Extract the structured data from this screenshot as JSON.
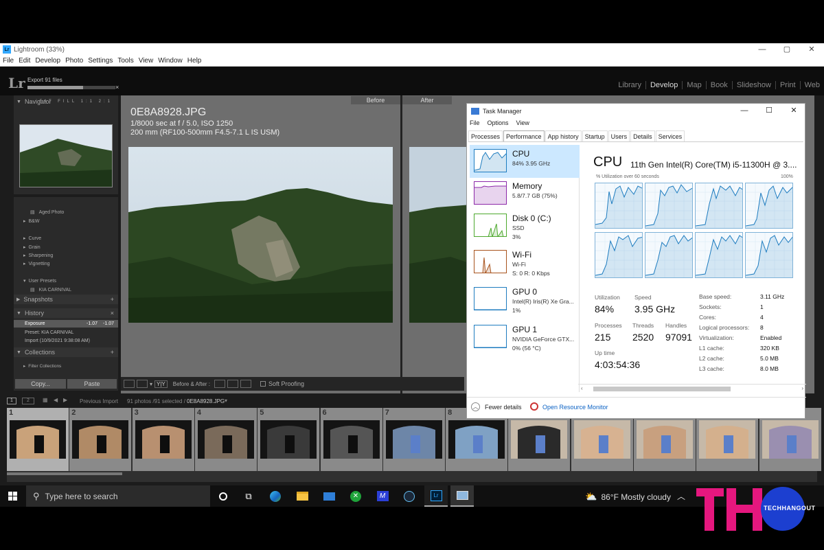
{
  "lightroom": {
    "title": "Lightroom (33%)",
    "window_controls": [
      "—",
      "▢",
      "✕"
    ],
    "menu": [
      "File",
      "Edit",
      "Develop",
      "Photo",
      "Settings",
      "Tools",
      "View",
      "Window",
      "Help"
    ],
    "logo": "Lr",
    "export_label": "Export 91 files",
    "export_close": "×",
    "export_progress": 0.63,
    "modules": [
      "Library",
      "Develop",
      "Map",
      "Book",
      "Slideshow",
      "Print",
      "Web"
    ],
    "active_module": "Develop",
    "navigator": {
      "title": "Navigator",
      "zoom_options": [
        "FIT",
        "FILL",
        "1:1",
        "2:1"
      ]
    },
    "presets": [
      "Aged Photo",
      "B&W",
      "Curve",
      "Grain",
      "Sharpening",
      "Vignetting",
      "User Presets",
      "KIA CARNIVAL"
    ],
    "snapshots_title": "Snapshots",
    "history": {
      "title": "History",
      "items": [
        {
          "label": "Exposure",
          "v1": "-1.07",
          "v2": "-1.07"
        },
        {
          "label": "Preset: KIA CARNIVAL",
          "v1": "",
          "v2": ""
        },
        {
          "label": "Import (10/9/2021 9:38:08 AM)",
          "v1": "",
          "v2": ""
        }
      ]
    },
    "collections_title": "Collections",
    "filter_collections": "Filter Collections",
    "copy_label": "Copy...",
    "paste_label": "Paste",
    "before_label": "Before",
    "after_label": "After",
    "photo": {
      "filename": "0E8A8928.JPG",
      "exposure": "1/8000 sec at f / 5.0, ISO 1250",
      "lens": "200 mm (RF100-500mm F4.5-7.1 L IS USM)"
    },
    "toolbar": {
      "yy": "Y|Y",
      "before_after": "Before & After :",
      "soft_proofing": "Soft Proofing"
    },
    "filmstrip_nav": {
      "source": "Previous Import",
      "count": "91 photos /91 selected /",
      "file": "0E8A8928.JPG"
    },
    "filmstrip_numbers": [
      "1",
      "2",
      "3",
      "4",
      "5",
      "6",
      "7",
      "8",
      "",
      "",
      "",
      "",
      ""
    ]
  },
  "task_manager": {
    "title": "Task Manager",
    "window_controls": [
      "—",
      "☐",
      "✕"
    ],
    "menu": [
      "File",
      "Options",
      "View"
    ],
    "tabs": [
      "Processes",
      "Performance",
      "App history",
      "Startup",
      "Users",
      "Details",
      "Services"
    ],
    "selected_tab": "Performance",
    "side_items": [
      {
        "name": "CPU",
        "sub1": "84%  3.95 GHz",
        "sub2": "",
        "color": "#1c7bbf"
      },
      {
        "name": "Memory",
        "sub1": "5.8/7.7 GB (75%)",
        "sub2": "",
        "color": "#8b27a8"
      },
      {
        "name": "Disk 0 (C:)",
        "sub1": "SSD",
        "sub2": "3%",
        "color": "#4ca82c"
      },
      {
        "name": "Wi-Fi",
        "sub1": "Wi-Fi",
        "sub2": "S: 0  R: 0 Kbps",
        "color": "#a7521b"
      },
      {
        "name": "GPU 0",
        "sub1": "Intel(R) Iris(R) Xe Gra...",
        "sub2": "1%",
        "color": "#1c7bbf"
      },
      {
        "name": "GPU 1",
        "sub1": "NVIDIA GeForce GTX...",
        "sub2": "0%  (56 °C)",
        "color": "#1c7bbf"
      }
    ],
    "cpu": {
      "title": "CPU",
      "model": "11th Gen Intel(R) Core(TM) i5-11300H @ 3....",
      "util_label": "% Utilization over 60 seconds",
      "util_max": "100%",
      "utilization_label": "Utilization",
      "utilization": "84%",
      "speed_label": "Speed",
      "speed": "3.95 GHz",
      "processes_label": "Processes",
      "processes": "215",
      "threads_label": "Threads",
      "threads": "2520",
      "handles_label": "Handles",
      "handles": "97091",
      "uptime_label": "Up time",
      "uptime": "4:03:54:36",
      "specs": [
        {
          "k": "Base speed:",
          "v": "3.11 GHz"
        },
        {
          "k": "Sockets:",
          "v": "1"
        },
        {
          "k": "Cores:",
          "v": "4"
        },
        {
          "k": "Logical processors:",
          "v": "8"
        },
        {
          "k": "Virtualization:",
          "v": "Enabled"
        },
        {
          "k": "L1 cache:",
          "v": "320 KB"
        },
        {
          "k": "L2 cache:",
          "v": "5.0 MB"
        },
        {
          "k": "L3 cache:",
          "v": "8.0 MB"
        }
      ]
    },
    "fewer_details": "Fewer details",
    "open_resource_monitor": "Open Resource Monitor"
  },
  "taskbar": {
    "search_placeholder": "Type here to search",
    "weather": "86°F  Mostly cloudy"
  },
  "watermark": {
    "letters": "TH",
    "brand": "TECHHANGOUT",
    "colors": {
      "pink": "#e5177e",
      "blue": "#1c3fd0"
    }
  }
}
